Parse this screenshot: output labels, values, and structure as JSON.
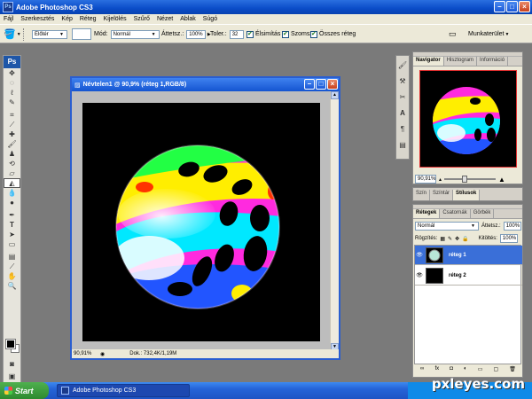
{
  "app": {
    "title": "Adobe Photoshop CS3",
    "logo": "Ps"
  },
  "menu": [
    "Fájl",
    "Szerkesztés",
    "Kép",
    "Réteg",
    "Kijelölés",
    "Szűrő",
    "Nézet",
    "Ablak",
    "Súgó"
  ],
  "options": {
    "preset_value": "Előtér",
    "mode_label": "Mód:",
    "mode_value": "Normál",
    "opacity_label": "Áttetsz.:",
    "opacity_value": "100%",
    "tolerance_label": "Toler.:",
    "tolerance_value": "32",
    "antialias_label": "Élsimítás",
    "contiguous_label": "Szomsz",
    "all_layers_label": "Összes réteg",
    "workspace_label": "Munkaterület"
  },
  "document": {
    "title": "Névtelen1 @ 90,9% (réteg 1,RGB/8)",
    "zoom": "90,91%",
    "doc_info": "Dok.: 732,4K/1,19M"
  },
  "navigator": {
    "tabs": [
      "Navigator",
      "Hisztogram",
      "Információ"
    ],
    "zoom": "90,91%"
  },
  "color_panel": {
    "tabs": [
      "Szín",
      "Színtár",
      "Stílusok"
    ]
  },
  "layers": {
    "tabs": [
      "Rétegek",
      "Csatornák",
      "Görbék"
    ],
    "blend_mode": "Normál",
    "opacity_label": "Áttetsz.:",
    "opacity_value": "100%",
    "lock_label": "Rögzítés:",
    "fill_label": "Kitöltés:",
    "fill_value": "100%",
    "items": [
      {
        "name": "réteg 1",
        "selected": true
      },
      {
        "name": "réteg 2",
        "selected": false
      }
    ]
  },
  "taskbar": {
    "start_label": "Start",
    "task_label": "Adobe Photoshop CS3"
  },
  "watermark": "pxleyes.com",
  "colors": {
    "accent": "#0a4cc8",
    "selection": "#3a6fd8"
  }
}
